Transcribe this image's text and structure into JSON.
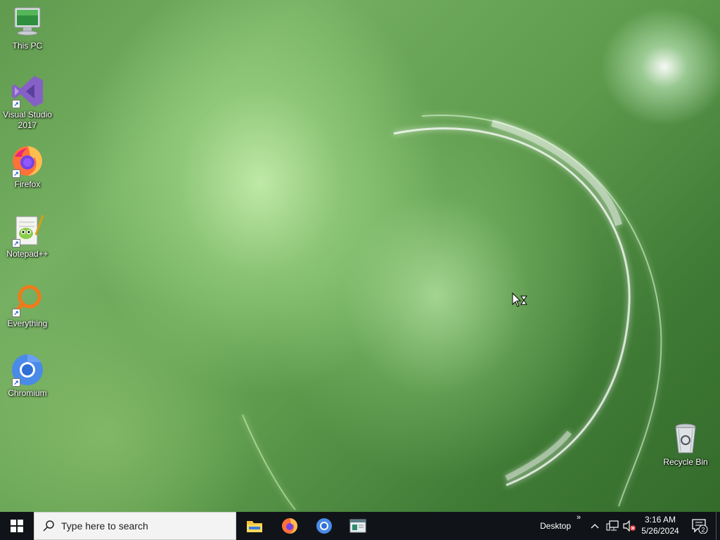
{
  "desktop": {
    "icons": [
      {
        "label": "This PC",
        "icon": "computer-icon"
      },
      {
        "label": "Visual Studio 2017",
        "icon": "visual-studio-icon"
      },
      {
        "label": "Firefox",
        "icon": "firefox-icon"
      },
      {
        "label": "Notepad++",
        "icon": "notepadpp-icon"
      },
      {
        "label": "Everything",
        "icon": "everything-icon"
      },
      {
        "label": "Chromium",
        "icon": "chromium-icon"
      }
    ],
    "recycle_bin": {
      "label": "Recycle Bin",
      "icon": "recycle-bin-icon"
    }
  },
  "taskbar": {
    "search_placeholder": "Type here to search",
    "pinned_apps": [
      "file-explorer-icon",
      "firefox-icon",
      "chromium-icon",
      "app-window-icon"
    ],
    "toolbar_label": "Desktop",
    "toolbar_overflow": "»",
    "clock": {
      "time": "3:16 AM",
      "date": "5/26/2024"
    },
    "notification_count": "2"
  },
  "colors": {
    "taskbar_bg": "#101418",
    "search_bg": "#f3f3f3",
    "accent_green": "#5f9a4e"
  }
}
